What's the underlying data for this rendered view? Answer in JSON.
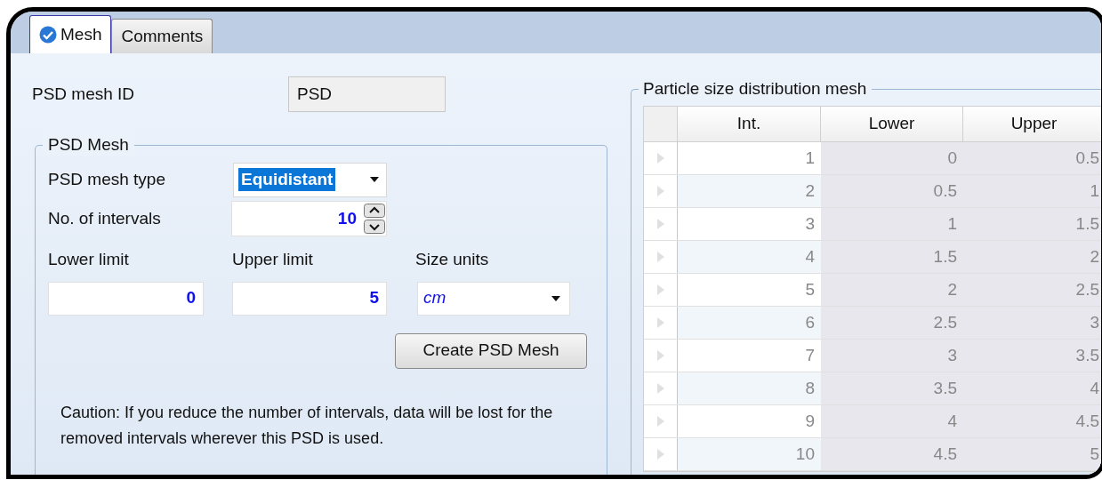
{
  "tabs": [
    {
      "label": "Mesh",
      "selected": true,
      "validated": true
    },
    {
      "label": "Comments",
      "selected": false,
      "validated": false
    }
  ],
  "mesh_id": {
    "label": "PSD mesh ID",
    "value": "PSD",
    "read_only": true
  },
  "psd_mesh": {
    "legend": "PSD Mesh",
    "mesh_type": {
      "label": "PSD mesh type",
      "value": "Equidistant",
      "focused": true
    },
    "intervals": {
      "label": "No. of intervals",
      "value": "10"
    },
    "lower_limit": {
      "label": "Lower limit",
      "value": "0"
    },
    "upper_limit": {
      "label": "Upper limit",
      "value": "5"
    },
    "size_units": {
      "label": "Size units",
      "value": "cm"
    },
    "create_button": "Create PSD Mesh",
    "caution": "Caution: If you reduce the number of intervals, data will be lost for the removed intervals wherever this PSD is used."
  },
  "distribution": {
    "legend": "Particle size distribution mesh",
    "columns": [
      {
        "label": "Int.",
        "read_only": false
      },
      {
        "label": "Lower",
        "read_only": true
      },
      {
        "label": "Upper",
        "read_only": true
      }
    ],
    "rows": [
      {
        "cells": [
          "1",
          "0",
          "0.5"
        ]
      },
      {
        "cells": [
          "2",
          "0.5",
          "1"
        ]
      },
      {
        "cells": [
          "3",
          "1",
          "1.5"
        ]
      },
      {
        "cells": [
          "4",
          "1.5",
          "2"
        ]
      },
      {
        "cells": [
          "5",
          "2",
          "2.5"
        ]
      },
      {
        "cells": [
          "6",
          "2.5",
          "3"
        ]
      },
      {
        "cells": [
          "7",
          "3",
          "3.5"
        ]
      },
      {
        "cells": [
          "8",
          "3.5",
          "4"
        ]
      },
      {
        "cells": [
          "9",
          "4",
          "4.5"
        ]
      },
      {
        "cells": [
          "10",
          "4.5",
          "5"
        ]
      }
    ]
  }
}
